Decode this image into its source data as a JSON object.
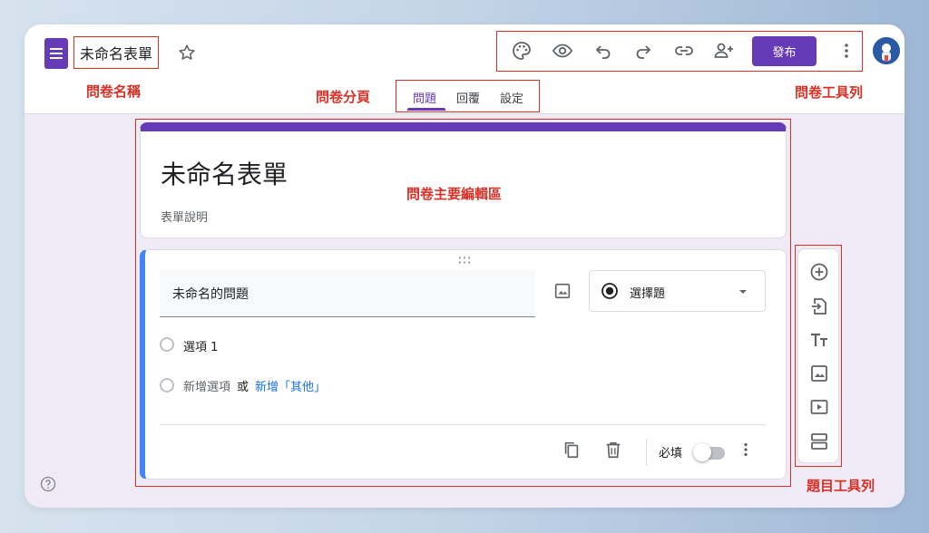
{
  "app": {
    "doc_title": "未命名表單",
    "publish_label": "發布"
  },
  "toolbar_icons": [
    "palette-icon",
    "preview-eye-icon",
    "undo-icon",
    "redo-icon",
    "link-icon",
    "add-collaborator-icon",
    "more-vert-icon"
  ],
  "tabs": [
    {
      "label": "問題",
      "active": true
    },
    {
      "label": "回覆",
      "active": false
    },
    {
      "label": "設定",
      "active": false
    }
  ],
  "form": {
    "title": "未命名表單",
    "description": "表單說明"
  },
  "question": {
    "title": "未命名的問題",
    "type_label": "選擇題",
    "option_1": "選項 1",
    "add_option": "新增選項",
    "or_text": "或",
    "add_other": "新增「其他」",
    "required_label": "必填",
    "required": false
  },
  "side_toolbar_icons": [
    "add-question-icon",
    "import-questions-icon",
    "add-title-icon",
    "add-image-icon",
    "add-video-icon",
    "add-section-icon"
  ],
  "annotations": {
    "form_name": "問卷名稱",
    "form_pages": "問卷分頁",
    "form_toolbar": "問卷工具列",
    "main_area": "問卷主要編輯區",
    "question_toolbar": "題目工具列"
  },
  "colors": {
    "accent": "#673ab7",
    "annotation": "#d93025",
    "question_bar": "#4285f4",
    "link": "#1a73e8"
  }
}
